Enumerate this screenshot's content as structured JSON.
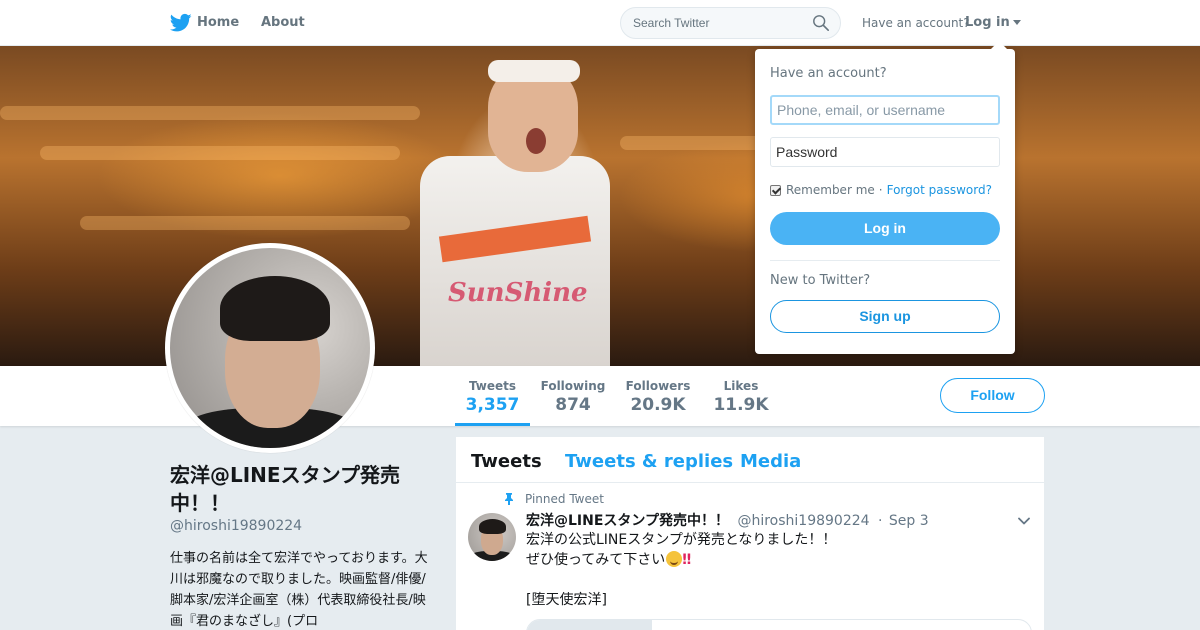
{
  "nav": {
    "home_label": "Home",
    "about_label": "About",
    "search_placeholder": "Search Twitter",
    "have_account": "Have an account?",
    "login_label": "Log in"
  },
  "login_dropdown": {
    "heading": "Have an account?",
    "username_placeholder": "Phone, email, or username",
    "password_placeholder": "Password",
    "remember_me": "Remember me",
    "separator": "·",
    "forgot_password": "Forgot password?",
    "login_button": "Log in",
    "new_to_twitter": "New to Twitter?",
    "signup_button": "Sign up",
    "remember_checked": true
  },
  "banner": {
    "shirt_text": "SunShine"
  },
  "stats": [
    {
      "label": "Tweets",
      "value": "3,357",
      "active": true
    },
    {
      "label": "Following",
      "value": "874",
      "active": false
    },
    {
      "label": "Followers",
      "value": "20.9K",
      "active": false
    },
    {
      "label": "Likes",
      "value": "11.9K",
      "active": false
    }
  ],
  "follow_button": "Follow",
  "profile": {
    "name": "宏洋@LINEスタンプ発売中！！",
    "handle": "@hiroshi19890224",
    "bio": "仕事の名前は全て宏洋でやっております。大川は邪魔なので取りました。映画監督/俳優/脚本家/宏洋企画室（株）代表取締役社長/映画『君のまなざし』(プロ"
  },
  "timeline": {
    "tabs": [
      "Tweets",
      "Tweets & replies",
      "Media"
    ],
    "active_tab": "Tweets"
  },
  "pinned_tweet": {
    "pinned_label": "Pinned Tweet",
    "fullname": "宏洋@LINEスタンプ発売中！！",
    "handle": "@hiroshi19890224",
    "dot": "·",
    "date": "Sep 3",
    "lines": [
      "宏洋の公式LINEスタンプが発売となりました！！",
      "ぜひ使ってみて下さい",
      "",
      "[堕天使宏洋]"
    ],
    "emoji_bang": "‼"
  },
  "colors": {
    "accent": "#1da1f2",
    "login_button_bg": "#4ab3f4",
    "page_bg": "#e6ecf0",
    "text_muted": "#657786"
  },
  "icons": [
    "twitter-bird-icon",
    "search-icon",
    "caret-down-icon",
    "pin-icon",
    "chevron-down-icon",
    "checkmark-icon"
  ]
}
